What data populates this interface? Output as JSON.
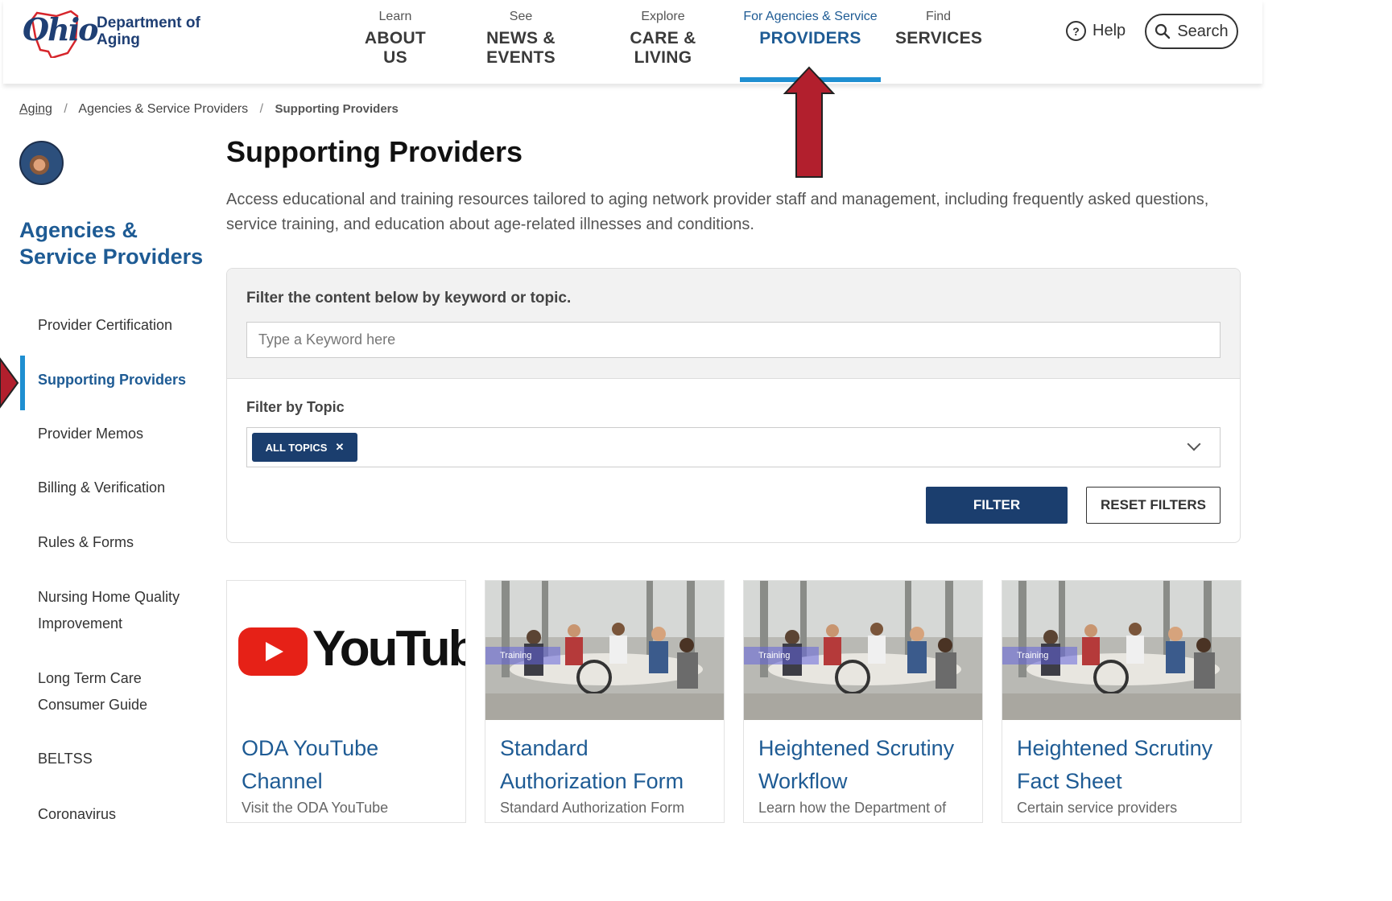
{
  "logo": {
    "wordmark": "Ohio",
    "dept_line1": "Department of",
    "dept_line2": "Aging"
  },
  "nav": [
    {
      "small": "Learn",
      "big": "ABOUT US"
    },
    {
      "small": "See",
      "big": "NEWS & EVENTS"
    },
    {
      "small": "Explore",
      "big": "CARE & LIVING"
    },
    {
      "small": "For Agencies & Service",
      "big": "PROVIDERS"
    },
    {
      "small": "Find",
      "big": "SERVICES"
    }
  ],
  "header_actions": {
    "help": "Help",
    "search": "Search"
  },
  "breadcrumb": [
    "Aging",
    "Agencies & Service Providers",
    "Supporting Providers"
  ],
  "sidebar": {
    "title": "Agencies & Service Providers",
    "items": [
      {
        "label": "Provider Certification"
      },
      {
        "label": "Supporting Providers"
      },
      {
        "label": "Provider Memos"
      },
      {
        "label": "Billing & Verification"
      },
      {
        "label": "Rules & Forms"
      },
      {
        "label": "Nursing Home Quality Improvement"
      },
      {
        "label": "Long Term Care Consumer Guide"
      },
      {
        "label": "BELTSS"
      },
      {
        "label": "Coronavirus"
      }
    ]
  },
  "main": {
    "title": "Supporting Providers",
    "intro": "Access educational and training resources tailored to aging network provider staff and management, including frequently asked questions, service training, and education about age-related illnesses and conditions."
  },
  "filter": {
    "label": "Filter the content below by keyword or topic.",
    "keyword_placeholder": "Type a Keyword here",
    "topic_label": "Filter by Topic",
    "chip": "ALL TOPICS",
    "filter_button": "FILTER",
    "reset_button": "RESET FILTERS"
  },
  "cards": [
    {
      "title": "ODA YouTube Channel",
      "desc": "Visit the ODA YouTube",
      "logo_text": "YouTube"
    },
    {
      "title": "Standard Authorization Form",
      "desc": "Standard Authorization Form",
      "tag": "Training"
    },
    {
      "title": "Heightened Scrutiny Workflow",
      "desc": "Learn how the Department of",
      "tag": "Training"
    },
    {
      "title": "Heightened Scrutiny Fact Sheet",
      "desc": "Certain service providers",
      "tag": "Training"
    }
  ],
  "colors": {
    "brand_blue": "#1e5b94",
    "accent_blue": "#1f8fd1",
    "dark_button": "#1b3e6e",
    "annotation_red": "#b21f2d"
  }
}
